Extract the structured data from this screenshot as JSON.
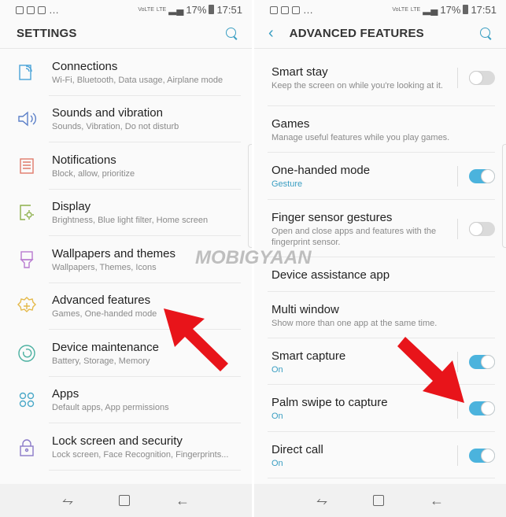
{
  "status_bar": {
    "battery": "17%",
    "time": "17:51",
    "network": [
      "VoLTE",
      "LTE"
    ]
  },
  "left": {
    "title": "SETTINGS",
    "items": [
      {
        "title": "Connections",
        "subtitle": "Wi-Fi, Bluetooth, Data usage, Airplane mode",
        "icon": "connections-icon",
        "color": "#4aa3d8"
      },
      {
        "title": "Sounds and vibration",
        "subtitle": "Sounds, Vibration, Do not disturb",
        "icon": "speaker-icon",
        "color": "#5b7fc8"
      },
      {
        "title": "Notifications",
        "subtitle": "Block, allow, prioritize",
        "icon": "notifications-icon",
        "color": "#e07a6a"
      },
      {
        "title": "Display",
        "subtitle": "Brightness, Blue light filter, Home screen",
        "icon": "display-icon",
        "color": "#8cb04a"
      },
      {
        "title": "Wallpapers and themes",
        "subtitle": "Wallpapers, Themes, Icons",
        "icon": "brush-icon",
        "color": "#b87ad0"
      },
      {
        "title": "Advanced features",
        "subtitle": "Games, One-handed mode",
        "icon": "gear-plus-icon",
        "color": "#e4b94a"
      },
      {
        "title": "Device maintenance",
        "subtitle": "Battery, Storage, Memory",
        "icon": "maintenance-icon",
        "color": "#4ab0a0"
      },
      {
        "title": "Apps",
        "subtitle": "Default apps, App permissions",
        "icon": "apps-icon",
        "color": "#4aa8c8"
      },
      {
        "title": "Lock screen and security",
        "subtitle": "Lock screen, Face Recognition, Fingerprints...",
        "icon": "lock-icon",
        "color": "#8a7ac8"
      }
    ]
  },
  "right": {
    "title": "ADVANCED FEATURES",
    "items": [
      {
        "title": "Smart stay",
        "subtitle": "Keep the screen on while you're looking at it.",
        "toggle": false
      },
      {
        "title": "Games",
        "subtitle": "Manage useful features while you play games."
      },
      {
        "title": "One-handed mode",
        "subtitle": "Gesture",
        "toggle": true,
        "accent": true
      },
      {
        "title": "Finger sensor gestures",
        "subtitle": "Open and close apps and features with the fingerprint sensor.",
        "toggle": false
      },
      {
        "title": "Device assistance app"
      },
      {
        "title": "Multi window",
        "subtitle": "Show more than one app at the same time."
      },
      {
        "title": "Smart capture",
        "subtitle": "On",
        "toggle": true,
        "accent": true
      },
      {
        "title": "Palm swipe to capture",
        "subtitle": "On",
        "toggle": true,
        "accent": true
      },
      {
        "title": "Direct call",
        "subtitle": "On",
        "toggle": true,
        "accent": true
      }
    ]
  },
  "watermark": "MOBIGYAAN",
  "colors": {
    "accent": "#4bb3dd",
    "arrow": "#e8141a",
    "background": "#fafafa"
  }
}
